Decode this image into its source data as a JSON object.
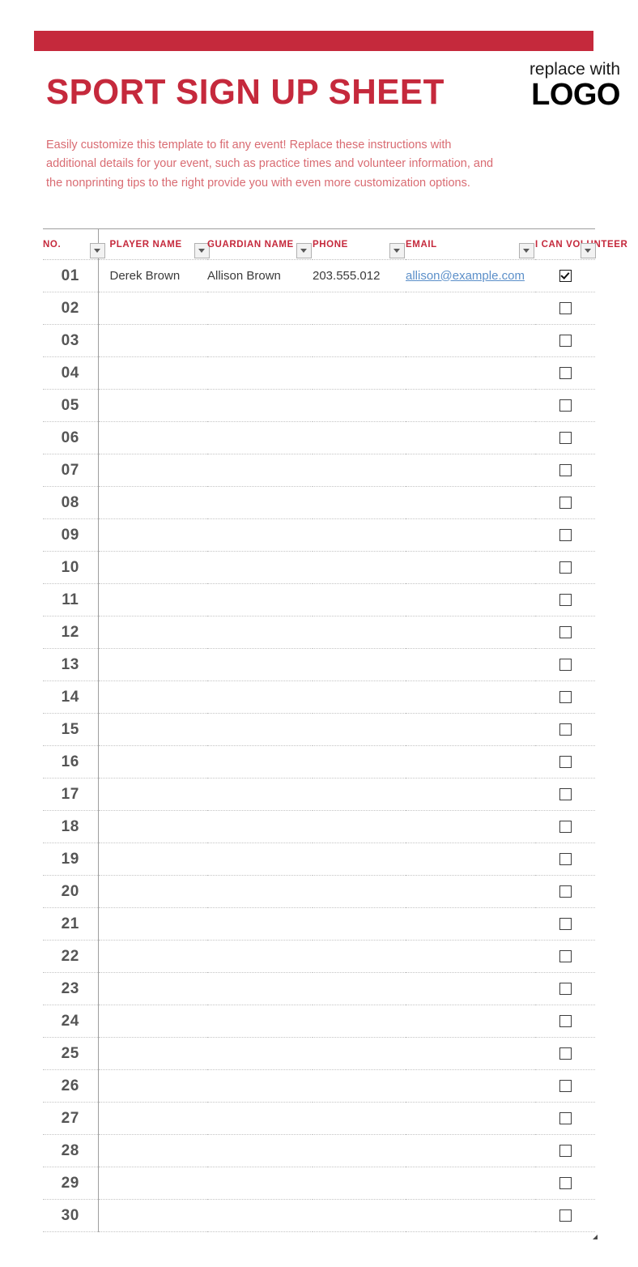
{
  "document": {
    "title": "SPORT SIGN UP SHEET",
    "accent_color": "#c5293c",
    "instructions_color": "#d96b72"
  },
  "logo": {
    "top_line": "replace with",
    "main_line": "LOGO"
  },
  "instructions": {
    "text": "Easily customize this template to fit any event! Replace these instructions with additional details for your event, such as practice times and volunteer information, and the nonprinting tips to the right provide you with even more customization options."
  },
  "table": {
    "columns": [
      {
        "key": "no",
        "label": "NO.",
        "filter": true
      },
      {
        "key": "player",
        "label": "PLAYER NAME",
        "filter": true
      },
      {
        "key": "guardian",
        "label": "GUARDIAN NAME",
        "filter": true
      },
      {
        "key": "phone",
        "label": "PHONE",
        "filter": true
      },
      {
        "key": "email",
        "label": "EMAIL",
        "filter": true
      },
      {
        "key": "volunteer",
        "label": "I CAN VOLUNTEER",
        "filter": true
      }
    ],
    "rows": [
      {
        "no": "01",
        "player": "Derek Brown",
        "guardian": "Allison Brown",
        "phone": "203.555.012",
        "email": "allison@example.com",
        "volunteer": true
      },
      {
        "no": "02",
        "player": "",
        "guardian": "",
        "phone": "",
        "email": "",
        "volunteer": false
      },
      {
        "no": "03",
        "player": "",
        "guardian": "",
        "phone": "",
        "email": "",
        "volunteer": false
      },
      {
        "no": "04",
        "player": "",
        "guardian": "",
        "phone": "",
        "email": "",
        "volunteer": false
      },
      {
        "no": "05",
        "player": "",
        "guardian": "",
        "phone": "",
        "email": "",
        "volunteer": false
      },
      {
        "no": "06",
        "player": "",
        "guardian": "",
        "phone": "",
        "email": "",
        "volunteer": false
      },
      {
        "no": "07",
        "player": "",
        "guardian": "",
        "phone": "",
        "email": "",
        "volunteer": false
      },
      {
        "no": "08",
        "player": "",
        "guardian": "",
        "phone": "",
        "email": "",
        "volunteer": false
      },
      {
        "no": "09",
        "player": "",
        "guardian": "",
        "phone": "",
        "email": "",
        "volunteer": false
      },
      {
        "no": "10",
        "player": "",
        "guardian": "",
        "phone": "",
        "email": "",
        "volunteer": false
      },
      {
        "no": "11",
        "player": "",
        "guardian": "",
        "phone": "",
        "email": "",
        "volunteer": false
      },
      {
        "no": "12",
        "player": "",
        "guardian": "",
        "phone": "",
        "email": "",
        "volunteer": false
      },
      {
        "no": "13",
        "player": "",
        "guardian": "",
        "phone": "",
        "email": "",
        "volunteer": false
      },
      {
        "no": "14",
        "player": "",
        "guardian": "",
        "phone": "",
        "email": "",
        "volunteer": false
      },
      {
        "no": "15",
        "player": "",
        "guardian": "",
        "phone": "",
        "email": "",
        "volunteer": false
      },
      {
        "no": "16",
        "player": "",
        "guardian": "",
        "phone": "",
        "email": "",
        "volunteer": false
      },
      {
        "no": "17",
        "player": "",
        "guardian": "",
        "phone": "",
        "email": "",
        "volunteer": false
      },
      {
        "no": "18",
        "player": "",
        "guardian": "",
        "phone": "",
        "email": "",
        "volunteer": false
      },
      {
        "no": "19",
        "player": "",
        "guardian": "",
        "phone": "",
        "email": "",
        "volunteer": false
      },
      {
        "no": "20",
        "player": "",
        "guardian": "",
        "phone": "",
        "email": "",
        "volunteer": false
      },
      {
        "no": "21",
        "player": "",
        "guardian": "",
        "phone": "",
        "email": "",
        "volunteer": false
      },
      {
        "no": "22",
        "player": "",
        "guardian": "",
        "phone": "",
        "email": "",
        "volunteer": false
      },
      {
        "no": "23",
        "player": "",
        "guardian": "",
        "phone": "",
        "email": "",
        "volunteer": false
      },
      {
        "no": "24",
        "player": "",
        "guardian": "",
        "phone": "",
        "email": "",
        "volunteer": false
      },
      {
        "no": "25",
        "player": "",
        "guardian": "",
        "phone": "",
        "email": "",
        "volunteer": false
      },
      {
        "no": "26",
        "player": "",
        "guardian": "",
        "phone": "",
        "email": "",
        "volunteer": false
      },
      {
        "no": "27",
        "player": "",
        "guardian": "",
        "phone": "",
        "email": "",
        "volunteer": false
      },
      {
        "no": "28",
        "player": "",
        "guardian": "",
        "phone": "",
        "email": "",
        "volunteer": false
      },
      {
        "no": "29",
        "player": "",
        "guardian": "",
        "phone": "",
        "email": "",
        "volunteer": false
      },
      {
        "no": "30",
        "player": "",
        "guardian": "",
        "phone": "",
        "email": "",
        "volunteer": false
      }
    ]
  }
}
